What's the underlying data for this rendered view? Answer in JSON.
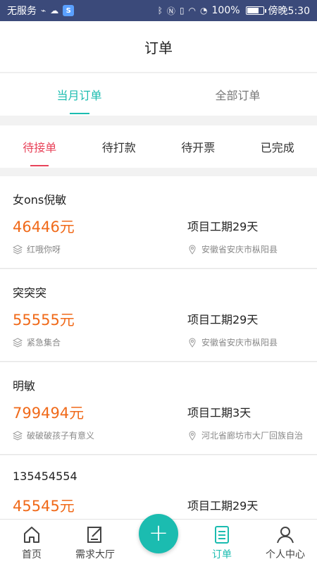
{
  "status_bar": {
    "carrier": "无服务",
    "battery": "100%",
    "time": "傍晚5:30",
    "app_badge": "S"
  },
  "header": {
    "title": "订单"
  },
  "primary_tabs": [
    {
      "label": "当月订单",
      "active": true
    },
    {
      "label": "全部订单",
      "active": false
    }
  ],
  "secondary_tabs": [
    {
      "label": "待接单",
      "active": true
    },
    {
      "label": "待打款",
      "active": false
    },
    {
      "label": "待开票",
      "active": false
    },
    {
      "label": "已完成",
      "active": false
    }
  ],
  "orders": [
    {
      "name": "女ons倪敏",
      "price": "46446元",
      "period": "项目工期29天",
      "category": "红哦你呀",
      "location": "安徽省安庆市枞阳县"
    },
    {
      "name": "突突突",
      "price": "55555元",
      "period": "项目工期29天",
      "category": "紧急集合",
      "location": "安徽省安庆市枞阳县"
    },
    {
      "name": "明敏",
      "price": "799494元",
      "period": "项目工期3天",
      "category": "破破破孩子有意义",
      "location": "河北省廊坊市大厂回族自治"
    },
    {
      "name": "135454554",
      "price": "45545元",
      "period": "项目工期29天",
      "category": "",
      "location": ""
    }
  ],
  "bottom_nav": [
    {
      "label": "首页",
      "icon": "home-icon",
      "active": false
    },
    {
      "label": "需求大厅",
      "icon": "edit-icon",
      "active": false
    },
    {
      "label": "订单",
      "icon": "order-icon",
      "active": true
    },
    {
      "label": "个人中心",
      "icon": "user-icon",
      "active": false
    }
  ],
  "fab": {
    "symbol": "+"
  },
  "colors": {
    "accent": "#1bbcb0",
    "tab_active": "#e8435a",
    "price": "#f06a1a",
    "status_bar": "#3b4a7a"
  }
}
